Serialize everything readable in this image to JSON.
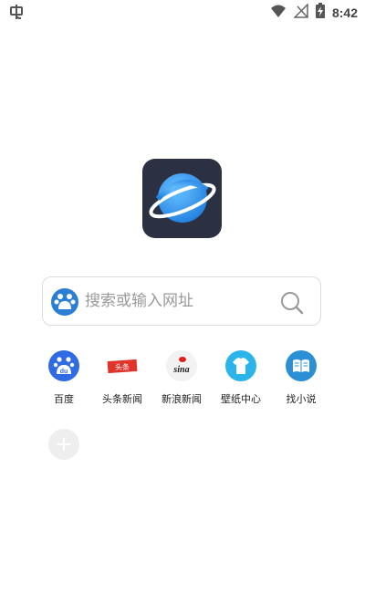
{
  "status_bar": {
    "time": "8:42",
    "left_icon": "bug-icon",
    "right_icons": [
      "wifi-icon",
      "no-signal-icon",
      "battery-charging-icon"
    ]
  },
  "app": {
    "logo_icon": "planet-logo-icon"
  },
  "search": {
    "placeholder": "搜索或输入网址",
    "value": "",
    "engine_icon": "baidu-paw-icon",
    "search_icon": "magnifier-icon"
  },
  "shortcuts": [
    {
      "label": "百度",
      "icon": "baidu-icon",
      "badge_text": "du",
      "color": "#2f6be3"
    },
    {
      "label": "头条新闻",
      "icon": "toutiao-icon",
      "badge_text": "头条",
      "color": "#e0342b"
    },
    {
      "label": "新浪新闻",
      "icon": "sina-icon",
      "badge_text": "sina",
      "color": "#e01d1d"
    },
    {
      "label": "壁纸中心",
      "icon": "tshirt-icon",
      "badge_text": "",
      "color": "#2ab4ea"
    },
    {
      "label": "找小说",
      "icon": "book-icon",
      "badge_text": "",
      "color": "#2b8fd6"
    }
  ],
  "add_shortcut_icon": "plus-icon",
  "colors": {
    "logo_bg": "#2b3142",
    "planet": "#3a9cf0",
    "border": "#dcdcdc"
  }
}
